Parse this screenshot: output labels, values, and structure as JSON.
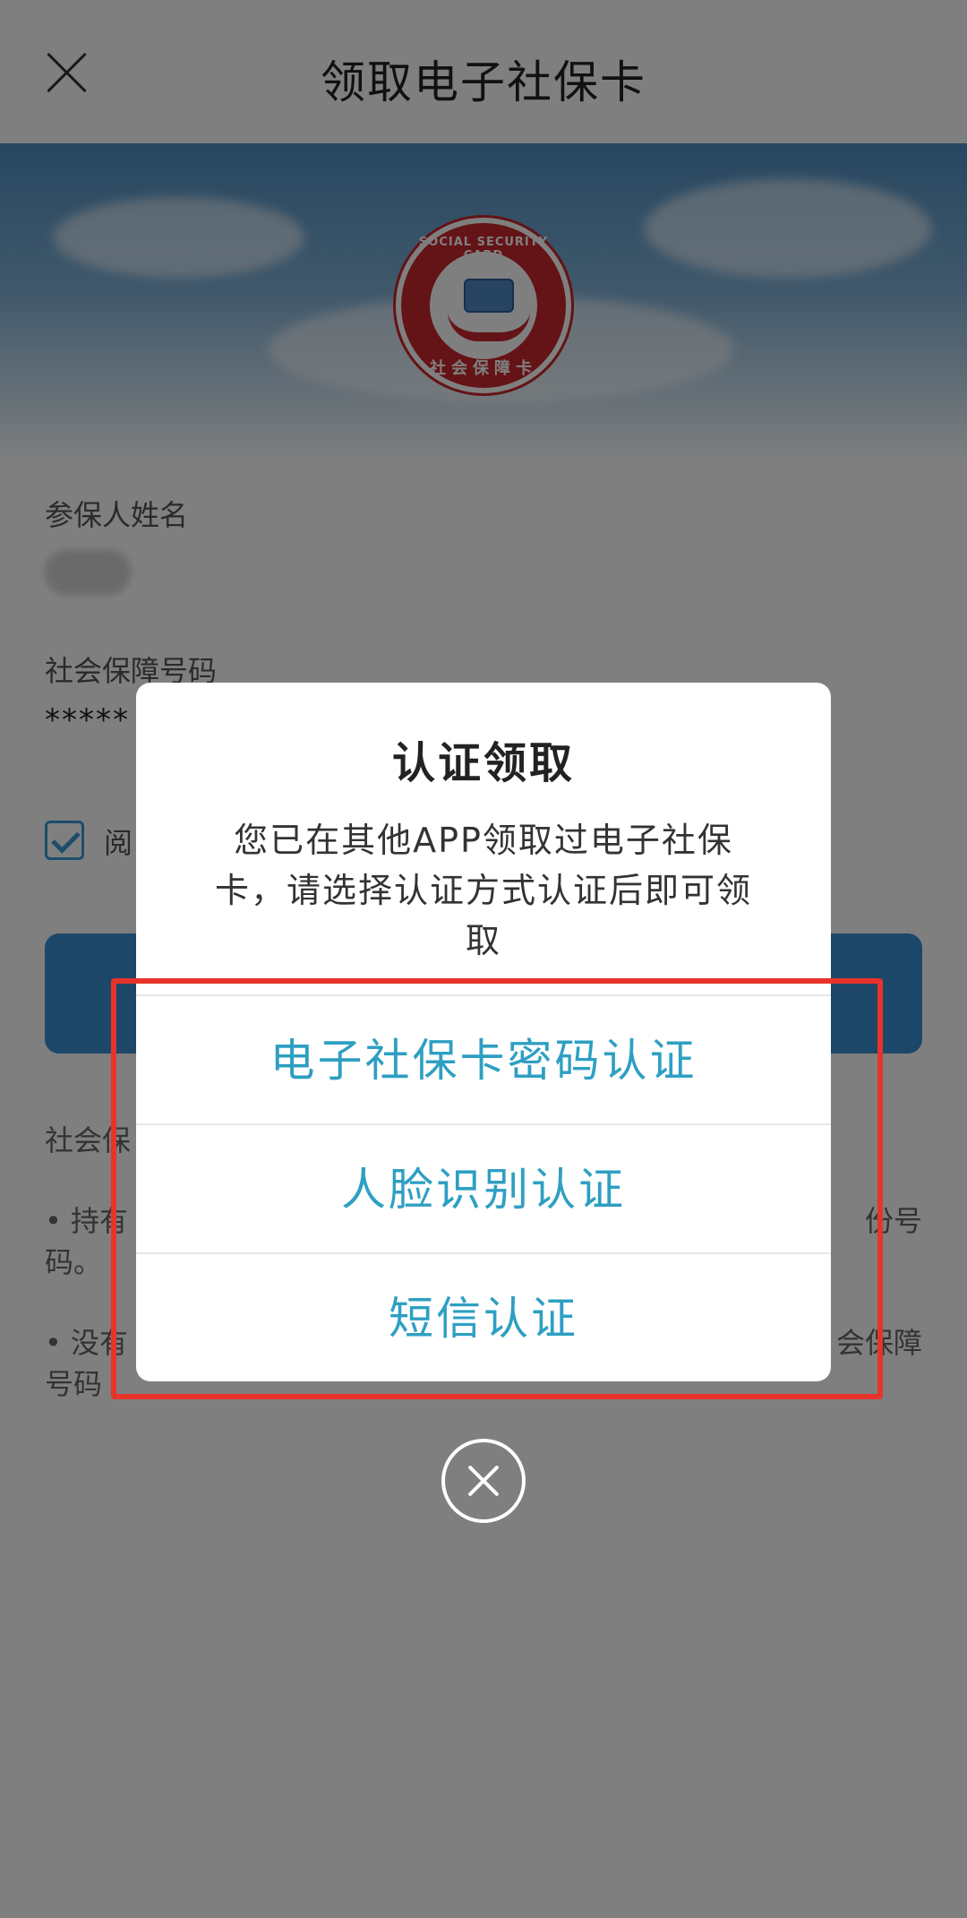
{
  "header": {
    "title": "领取电子社保卡",
    "close_icon": "close-icon"
  },
  "logo": {
    "ring_text": "SOCIAL SECURITY CARD",
    "bottom_text": "社会保障卡"
  },
  "form": {
    "name_label": "参保人姓名",
    "ssn_label": "社会保障号码",
    "ssn_value": "*****",
    "agree_text": "阅",
    "agree_checked": true,
    "notes_heading": "社会保",
    "note1_start": "• 持有",
    "note1_end": "份号",
    "note1_line2": "码。",
    "note2_start": "• 没有",
    "note2_end": "会保障",
    "note2_line2": "号码"
  },
  "dialog": {
    "title": "认证领取",
    "message_line1": "您已在其他APP领取过电子社保",
    "message_line2": "卡，请选择认证方式认证后即可领",
    "message_line3": "取",
    "options": [
      {
        "label": "电子社保卡密码认证"
      },
      {
        "label": "人脸识别认证"
      },
      {
        "label": "短信认证"
      }
    ],
    "close_icon": "close-circle-icon"
  },
  "colors": {
    "option_text": "#2e9fc2",
    "highlight": "#e8332b",
    "primary": "#3a8fd0"
  }
}
